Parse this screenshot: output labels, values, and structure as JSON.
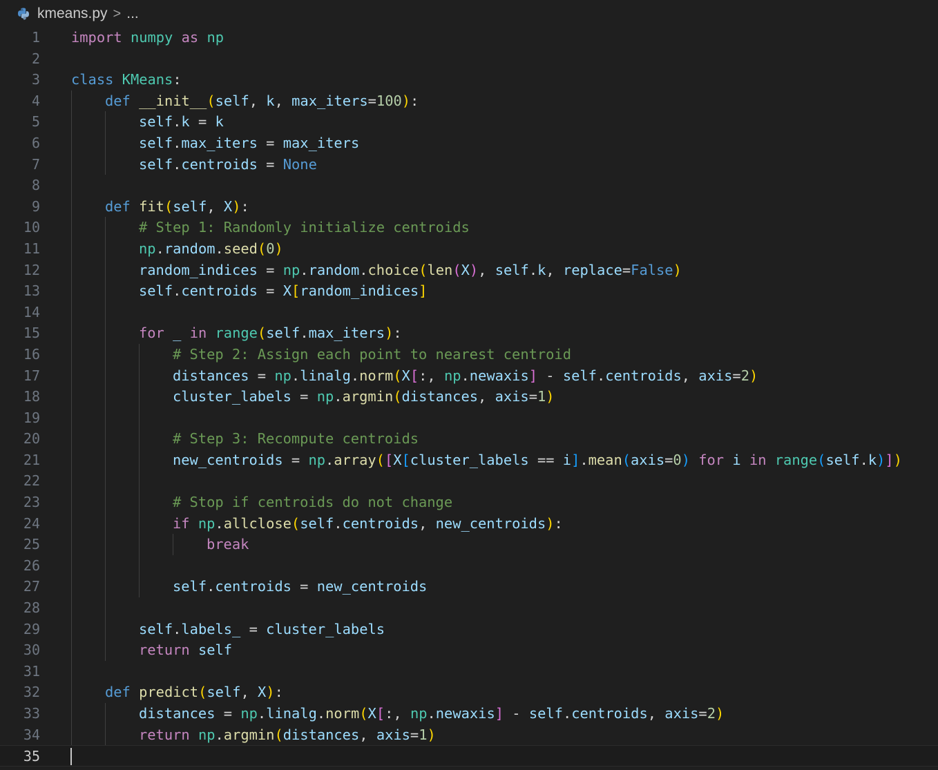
{
  "breadcrumb": {
    "file_name": "kmeans.py",
    "separator": ">",
    "more": "..."
  },
  "editor": {
    "language": "python",
    "current_line": 35,
    "lines": [
      {
        "n": 1,
        "indent": 0,
        "tokens": [
          [
            "kw",
            "import"
          ],
          [
            "pl",
            " "
          ],
          [
            "cls",
            "numpy"
          ],
          [
            "pl",
            " "
          ],
          [
            "kw",
            "as"
          ],
          [
            "pl",
            " "
          ],
          [
            "cls",
            "np"
          ]
        ]
      },
      {
        "n": 2,
        "indent": 0,
        "tokens": []
      },
      {
        "n": 3,
        "indent": 0,
        "tokens": [
          [
            "st",
            "class"
          ],
          [
            "pl",
            " "
          ],
          [
            "cls",
            "KMeans"
          ],
          [
            "pl",
            ":"
          ]
        ]
      },
      {
        "n": 4,
        "indent": 1,
        "tokens": [
          [
            "st",
            "def"
          ],
          [
            "pl",
            " "
          ],
          [
            "fn",
            "__init__"
          ],
          [
            "b1",
            "("
          ],
          [
            "vr",
            "self"
          ],
          [
            "pl",
            ", "
          ],
          [
            "vr",
            "k"
          ],
          [
            "pl",
            ", "
          ],
          [
            "vr",
            "max_iters"
          ],
          [
            "pl",
            "="
          ],
          [
            "num",
            "100"
          ],
          [
            "b1",
            ")"
          ],
          [
            "pl",
            ":"
          ]
        ]
      },
      {
        "n": 5,
        "indent": 2,
        "tokens": [
          [
            "vr",
            "self"
          ],
          [
            "pl",
            "."
          ],
          [
            "vr",
            "k"
          ],
          [
            "pl",
            " = "
          ],
          [
            "vr",
            "k"
          ]
        ]
      },
      {
        "n": 6,
        "indent": 2,
        "tokens": [
          [
            "vr",
            "self"
          ],
          [
            "pl",
            "."
          ],
          [
            "vr",
            "max_iters"
          ],
          [
            "pl",
            " = "
          ],
          [
            "vr",
            "max_iters"
          ]
        ]
      },
      {
        "n": 7,
        "indent": 2,
        "tokens": [
          [
            "vr",
            "self"
          ],
          [
            "pl",
            "."
          ],
          [
            "vr",
            "centroids"
          ],
          [
            "pl",
            " = "
          ],
          [
            "st",
            "None"
          ]
        ]
      },
      {
        "n": 8,
        "indent": 0,
        "tokens": []
      },
      {
        "n": 9,
        "indent": 1,
        "tokens": [
          [
            "st",
            "def"
          ],
          [
            "pl",
            " "
          ],
          [
            "fn",
            "fit"
          ],
          [
            "b1",
            "("
          ],
          [
            "vr",
            "self"
          ],
          [
            "pl",
            ", "
          ],
          [
            "vr",
            "X"
          ],
          [
            "b1",
            ")"
          ],
          [
            "pl",
            ":"
          ]
        ]
      },
      {
        "n": 10,
        "indent": 2,
        "tokens": [
          [
            "cm",
            "# Step 1: Randomly initialize centroids"
          ]
        ]
      },
      {
        "n": 11,
        "indent": 2,
        "tokens": [
          [
            "cls",
            "np"
          ],
          [
            "pl",
            "."
          ],
          [
            "vr",
            "random"
          ],
          [
            "pl",
            "."
          ],
          [
            "fn",
            "seed"
          ],
          [
            "b1",
            "("
          ],
          [
            "num",
            "0"
          ],
          [
            "b1",
            ")"
          ]
        ]
      },
      {
        "n": 12,
        "indent": 2,
        "tokens": [
          [
            "vr",
            "random_indices"
          ],
          [
            "pl",
            " = "
          ],
          [
            "cls",
            "np"
          ],
          [
            "pl",
            "."
          ],
          [
            "vr",
            "random"
          ],
          [
            "pl",
            "."
          ],
          [
            "fn",
            "choice"
          ],
          [
            "b1",
            "("
          ],
          [
            "fn",
            "len"
          ],
          [
            "b2",
            "("
          ],
          [
            "vr",
            "X"
          ],
          [
            "b2",
            ")"
          ],
          [
            "pl",
            ", "
          ],
          [
            "vr",
            "self"
          ],
          [
            "pl",
            "."
          ],
          [
            "vr",
            "k"
          ],
          [
            "pl",
            ", "
          ],
          [
            "vr",
            "replace"
          ],
          [
            "pl",
            "="
          ],
          [
            "st",
            "False"
          ],
          [
            "b1",
            ")"
          ]
        ]
      },
      {
        "n": 13,
        "indent": 2,
        "tokens": [
          [
            "vr",
            "self"
          ],
          [
            "pl",
            "."
          ],
          [
            "vr",
            "centroids"
          ],
          [
            "pl",
            " = "
          ],
          [
            "vr",
            "X"
          ],
          [
            "b1",
            "["
          ],
          [
            "vr",
            "random_indices"
          ],
          [
            "b1",
            "]"
          ]
        ]
      },
      {
        "n": 14,
        "indent": 0,
        "tokens": []
      },
      {
        "n": 15,
        "indent": 2,
        "tokens": [
          [
            "kw",
            "for"
          ],
          [
            "pl",
            " "
          ],
          [
            "vr",
            "_"
          ],
          [
            "pl",
            " "
          ],
          [
            "kw",
            "in"
          ],
          [
            "pl",
            " "
          ],
          [
            "cls",
            "range"
          ],
          [
            "b1",
            "("
          ],
          [
            "vr",
            "self"
          ],
          [
            "pl",
            "."
          ],
          [
            "vr",
            "max_iters"
          ],
          [
            "b1",
            ")"
          ],
          [
            "pl",
            ":"
          ]
        ]
      },
      {
        "n": 16,
        "indent": 3,
        "tokens": [
          [
            "cm",
            "# Step 2: Assign each point to nearest centroid"
          ]
        ]
      },
      {
        "n": 17,
        "indent": 3,
        "tokens": [
          [
            "vr",
            "distances"
          ],
          [
            "pl",
            " = "
          ],
          [
            "cls",
            "np"
          ],
          [
            "pl",
            "."
          ],
          [
            "vr",
            "linalg"
          ],
          [
            "pl",
            "."
          ],
          [
            "fn",
            "norm"
          ],
          [
            "b1",
            "("
          ],
          [
            "vr",
            "X"
          ],
          [
            "b2",
            "["
          ],
          [
            "pl",
            ":, "
          ],
          [
            "cls",
            "np"
          ],
          [
            "pl",
            "."
          ],
          [
            "vr",
            "newaxis"
          ],
          [
            "b2",
            "]"
          ],
          [
            "pl",
            " - "
          ],
          [
            "vr",
            "self"
          ],
          [
            "pl",
            "."
          ],
          [
            "vr",
            "centroids"
          ],
          [
            "pl",
            ", "
          ],
          [
            "vr",
            "axis"
          ],
          [
            "pl",
            "="
          ],
          [
            "num",
            "2"
          ],
          [
            "b1",
            ")"
          ]
        ]
      },
      {
        "n": 18,
        "indent": 3,
        "tokens": [
          [
            "vr",
            "cluster_labels"
          ],
          [
            "pl",
            " = "
          ],
          [
            "cls",
            "np"
          ],
          [
            "pl",
            "."
          ],
          [
            "fn",
            "argmin"
          ],
          [
            "b1",
            "("
          ],
          [
            "vr",
            "distances"
          ],
          [
            "pl",
            ", "
          ],
          [
            "vr",
            "axis"
          ],
          [
            "pl",
            "="
          ],
          [
            "num",
            "1"
          ],
          [
            "b1",
            ")"
          ]
        ]
      },
      {
        "n": 19,
        "indent": 0,
        "tokens": []
      },
      {
        "n": 20,
        "indent": 3,
        "tokens": [
          [
            "cm",
            "# Step 3: Recompute centroids"
          ]
        ]
      },
      {
        "n": 21,
        "indent": 3,
        "tokens": [
          [
            "vr",
            "new_centroids"
          ],
          [
            "pl",
            " = "
          ],
          [
            "cls",
            "np"
          ],
          [
            "pl",
            "."
          ],
          [
            "fn",
            "array"
          ],
          [
            "b1",
            "("
          ],
          [
            "b2",
            "["
          ],
          [
            "vr",
            "X"
          ],
          [
            "b3",
            "["
          ],
          [
            "vr",
            "cluster_labels"
          ],
          [
            "pl",
            " == "
          ],
          [
            "vr",
            "i"
          ],
          [
            "b3",
            "]"
          ],
          [
            "pl",
            "."
          ],
          [
            "fn",
            "mean"
          ],
          [
            "b3",
            "("
          ],
          [
            "vr",
            "axis"
          ],
          [
            "pl",
            "="
          ],
          [
            "num",
            "0"
          ],
          [
            "b3",
            ")"
          ],
          [
            "pl",
            " "
          ],
          [
            "kw",
            "for"
          ],
          [
            "pl",
            " "
          ],
          [
            "vr",
            "i"
          ],
          [
            "pl",
            " "
          ],
          [
            "kw",
            "in"
          ],
          [
            "pl",
            " "
          ],
          [
            "cls",
            "range"
          ],
          [
            "b3",
            "("
          ],
          [
            "vr",
            "self"
          ],
          [
            "pl",
            "."
          ],
          [
            "vr",
            "k"
          ],
          [
            "b3",
            ")"
          ],
          [
            "b2",
            "]"
          ],
          [
            "b1",
            ")"
          ]
        ]
      },
      {
        "n": 22,
        "indent": 0,
        "tokens": []
      },
      {
        "n": 23,
        "indent": 3,
        "tokens": [
          [
            "cm",
            "# Stop if centroids do not change"
          ]
        ]
      },
      {
        "n": 24,
        "indent": 3,
        "tokens": [
          [
            "kw",
            "if"
          ],
          [
            "pl",
            " "
          ],
          [
            "cls",
            "np"
          ],
          [
            "pl",
            "."
          ],
          [
            "fn",
            "allclose"
          ],
          [
            "b1",
            "("
          ],
          [
            "vr",
            "self"
          ],
          [
            "pl",
            "."
          ],
          [
            "vr",
            "centroids"
          ],
          [
            "pl",
            ", "
          ],
          [
            "vr",
            "new_centroids"
          ],
          [
            "b1",
            ")"
          ],
          [
            "pl",
            ":"
          ]
        ]
      },
      {
        "n": 25,
        "indent": 4,
        "tokens": [
          [
            "kw",
            "break"
          ]
        ]
      },
      {
        "n": 26,
        "indent": 0,
        "tokens": []
      },
      {
        "n": 27,
        "indent": 3,
        "tokens": [
          [
            "vr",
            "self"
          ],
          [
            "pl",
            "."
          ],
          [
            "vr",
            "centroids"
          ],
          [
            "pl",
            " = "
          ],
          [
            "vr",
            "new_centroids"
          ]
        ]
      },
      {
        "n": 28,
        "indent": 0,
        "tokens": []
      },
      {
        "n": 29,
        "indent": 2,
        "tokens": [
          [
            "vr",
            "self"
          ],
          [
            "pl",
            "."
          ],
          [
            "vr",
            "labels_"
          ],
          [
            "pl",
            " = "
          ],
          [
            "vr",
            "cluster_labels"
          ]
        ]
      },
      {
        "n": 30,
        "indent": 2,
        "tokens": [
          [
            "kw",
            "return"
          ],
          [
            "pl",
            " "
          ],
          [
            "vr",
            "self"
          ]
        ]
      },
      {
        "n": 31,
        "indent": 0,
        "tokens": []
      },
      {
        "n": 32,
        "indent": 1,
        "tokens": [
          [
            "st",
            "def"
          ],
          [
            "pl",
            " "
          ],
          [
            "fn",
            "predict"
          ],
          [
            "b1",
            "("
          ],
          [
            "vr",
            "self"
          ],
          [
            "pl",
            ", "
          ],
          [
            "vr",
            "X"
          ],
          [
            "b1",
            ")"
          ],
          [
            "pl",
            ":"
          ]
        ]
      },
      {
        "n": 33,
        "indent": 2,
        "tokens": [
          [
            "vr",
            "distances"
          ],
          [
            "pl",
            " = "
          ],
          [
            "cls",
            "np"
          ],
          [
            "pl",
            "."
          ],
          [
            "vr",
            "linalg"
          ],
          [
            "pl",
            "."
          ],
          [
            "fn",
            "norm"
          ],
          [
            "b1",
            "("
          ],
          [
            "vr",
            "X"
          ],
          [
            "b2",
            "["
          ],
          [
            "pl",
            ":, "
          ],
          [
            "cls",
            "np"
          ],
          [
            "pl",
            "."
          ],
          [
            "vr",
            "newaxis"
          ],
          [
            "b2",
            "]"
          ],
          [
            "pl",
            " - "
          ],
          [
            "vr",
            "self"
          ],
          [
            "pl",
            "."
          ],
          [
            "vr",
            "centroids"
          ],
          [
            "pl",
            ", "
          ],
          [
            "vr",
            "axis"
          ],
          [
            "pl",
            "="
          ],
          [
            "num",
            "2"
          ],
          [
            "b1",
            ")"
          ]
        ]
      },
      {
        "n": 34,
        "indent": 2,
        "tokens": [
          [
            "kw",
            "return"
          ],
          [
            "pl",
            " "
          ],
          [
            "cls",
            "np"
          ],
          [
            "pl",
            "."
          ],
          [
            "fn",
            "argmin"
          ],
          [
            "b1",
            "("
          ],
          [
            "vr",
            "distances"
          ],
          [
            "pl",
            ", "
          ],
          [
            "vr",
            "axis"
          ],
          [
            "pl",
            "="
          ],
          [
            "num",
            "1"
          ],
          [
            "b1",
            ")"
          ]
        ]
      },
      {
        "n": 35,
        "indent": 0,
        "tokens": []
      }
    ],
    "indent_guides": [
      {
        "level": 1,
        "from": 4,
        "to": 34
      },
      {
        "level": 2,
        "from": 5,
        "to": 7
      },
      {
        "level": 2,
        "from": 10,
        "to": 30
      },
      {
        "level": 3,
        "from": 16,
        "to": 27
      },
      {
        "level": 4,
        "from": 25,
        "to": 25
      },
      {
        "level": 2,
        "from": 33,
        "to": 34
      }
    ]
  }
}
